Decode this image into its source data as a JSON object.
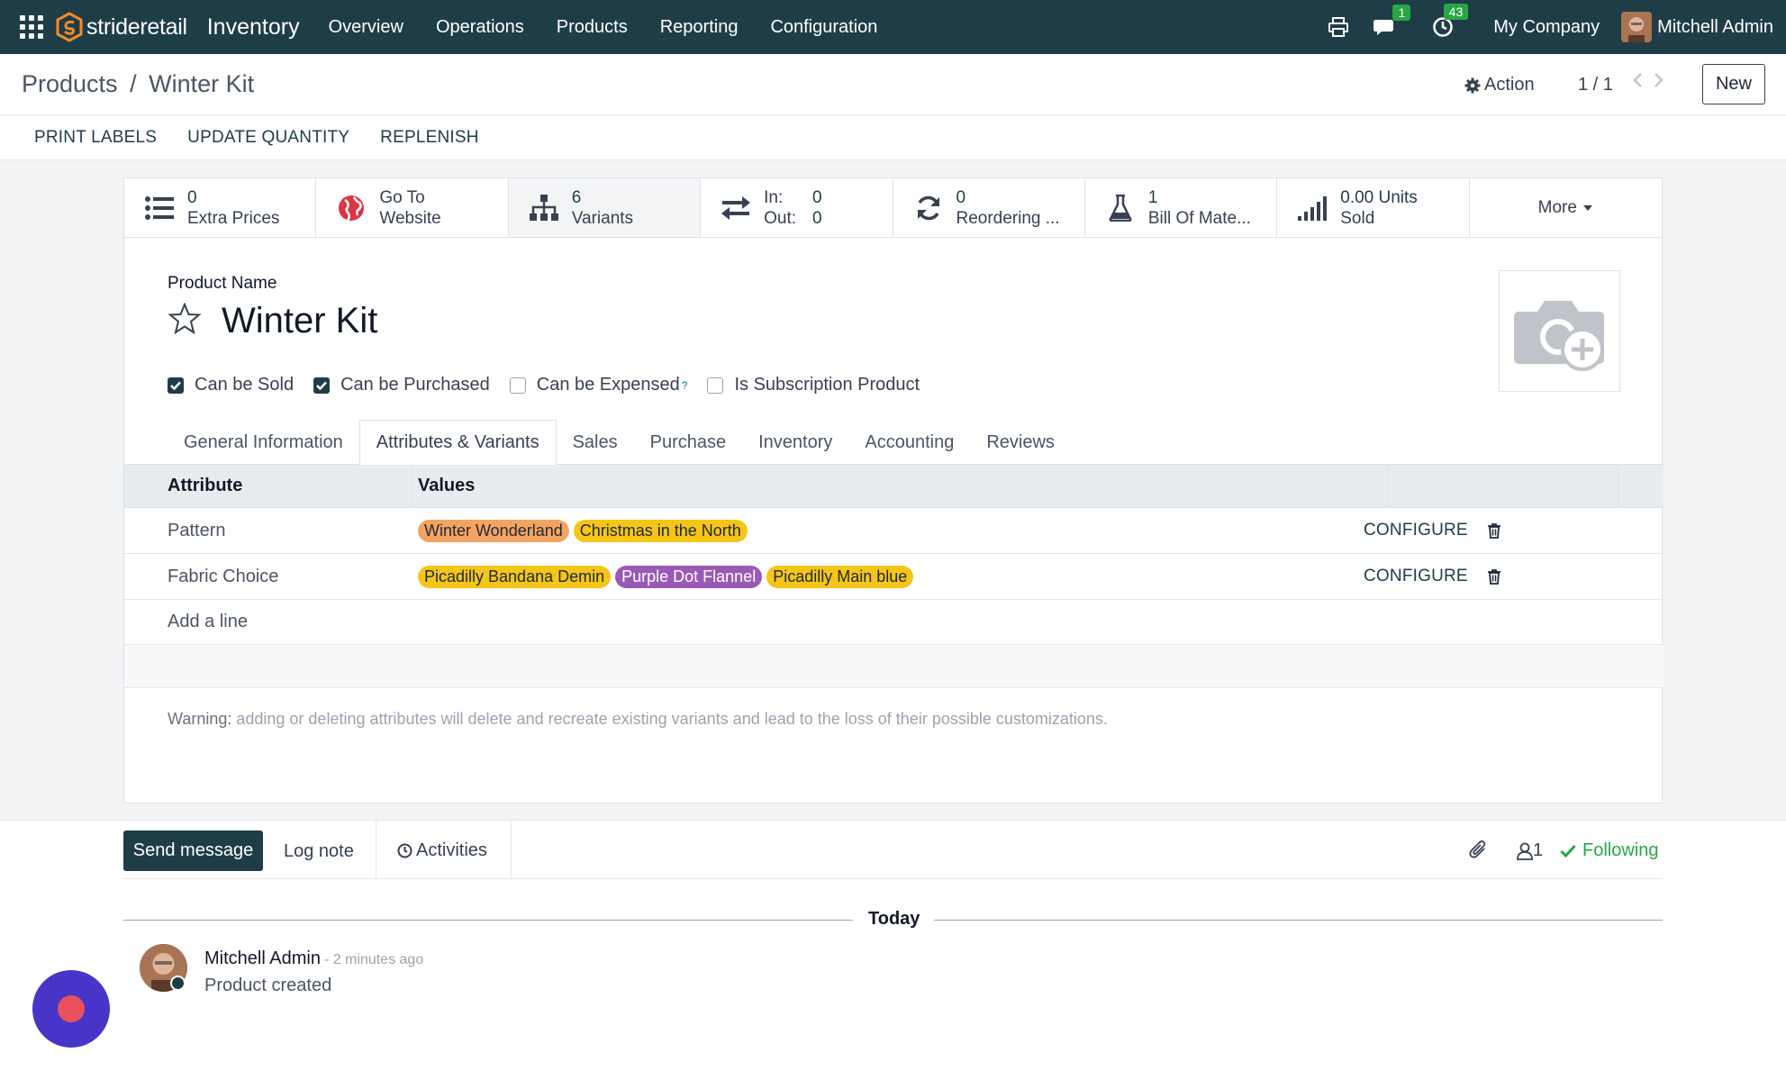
{
  "navbar": {
    "brand": "strideretail",
    "app_name": "Inventory",
    "menu": [
      "Overview",
      "Operations",
      "Products",
      "Reporting",
      "Configuration"
    ],
    "messages_badge": "1",
    "activities_badge": "43",
    "company": "My Company",
    "user": "Mitchell Admin"
  },
  "control": {
    "breadcrumb_parent": "Products",
    "breadcrumb_sep": "/",
    "breadcrumb_current": "Winter Kit",
    "action_label": "Action",
    "pager": "1 / 1",
    "new_label": "New"
  },
  "statusbar": {
    "buttons": [
      "PRINT LABELS",
      "UPDATE QUANTITY",
      "REPLENISH"
    ]
  },
  "smart_buttons": {
    "extra_prices": {
      "value": "0",
      "label": "Extra Prices"
    },
    "website": {
      "line1": "Go To",
      "line2": "Website"
    },
    "variants": {
      "value": "6",
      "label": "Variants"
    },
    "in_out": {
      "in_label": "In:",
      "in_value": "0",
      "out_label": "Out:",
      "out_value": "0"
    },
    "reordering": {
      "value": "0",
      "label": "Reordering ..."
    },
    "bom": {
      "value": "1",
      "label": "Bill Of Mate..."
    },
    "sold": {
      "value": "0.00 Units",
      "label": "Sold"
    },
    "more": "More"
  },
  "product": {
    "name_label": "Product Name",
    "name": "Winter Kit",
    "checkboxes": [
      {
        "label": "Can be Sold",
        "checked": true
      },
      {
        "label": "Can be Purchased",
        "checked": true
      },
      {
        "label": "Can be Expensed",
        "checked": false,
        "tooltip": "?"
      },
      {
        "label": "Is Subscription Product",
        "checked": false
      }
    ]
  },
  "tabs": [
    "General Information",
    "Attributes & Variants",
    "Sales",
    "Purchase",
    "Inventory",
    "Accounting",
    "Reviews"
  ],
  "active_tab": "Attributes & Variants",
  "attributes_table": {
    "headers": {
      "attribute": "Attribute",
      "values": "Values"
    },
    "rows": [
      {
        "attribute": "Pattern",
        "values": [
          {
            "label": "Winter Wonderland",
            "color": "#f4a460"
          },
          {
            "label": "Christmas in the North",
            "color": "#f5c518"
          }
        ],
        "action": "CONFIGURE"
      },
      {
        "attribute": "Fabric Choice",
        "values": [
          {
            "label": "Picadilly Bandana Demin",
            "color": "#f5c518"
          },
          {
            "label": "Purple Dot Flannel",
            "color": "#9b59b6"
          },
          {
            "label": "Picadilly Main blue",
            "color": "#f5c518"
          }
        ],
        "action": "CONFIGURE"
      }
    ],
    "add_line": "Add a line"
  },
  "warning": {
    "prefix": "Warning:",
    "text": " adding or deleting attributes will delete and recreate existing variants and lead to the loss of their possible customizations."
  },
  "chatter": {
    "send_message": "Send message",
    "log_note": "Log note",
    "activities": "Activities",
    "followers_count": "1",
    "following": "Following",
    "date_separator": "Today",
    "messages": [
      {
        "author": "Mitchell Admin",
        "time": "- 2 minutes ago",
        "body": "Product created"
      }
    ]
  },
  "colors": {
    "primary": "#1f3d47",
    "accent": "#017e84",
    "success": "#28a745"
  }
}
